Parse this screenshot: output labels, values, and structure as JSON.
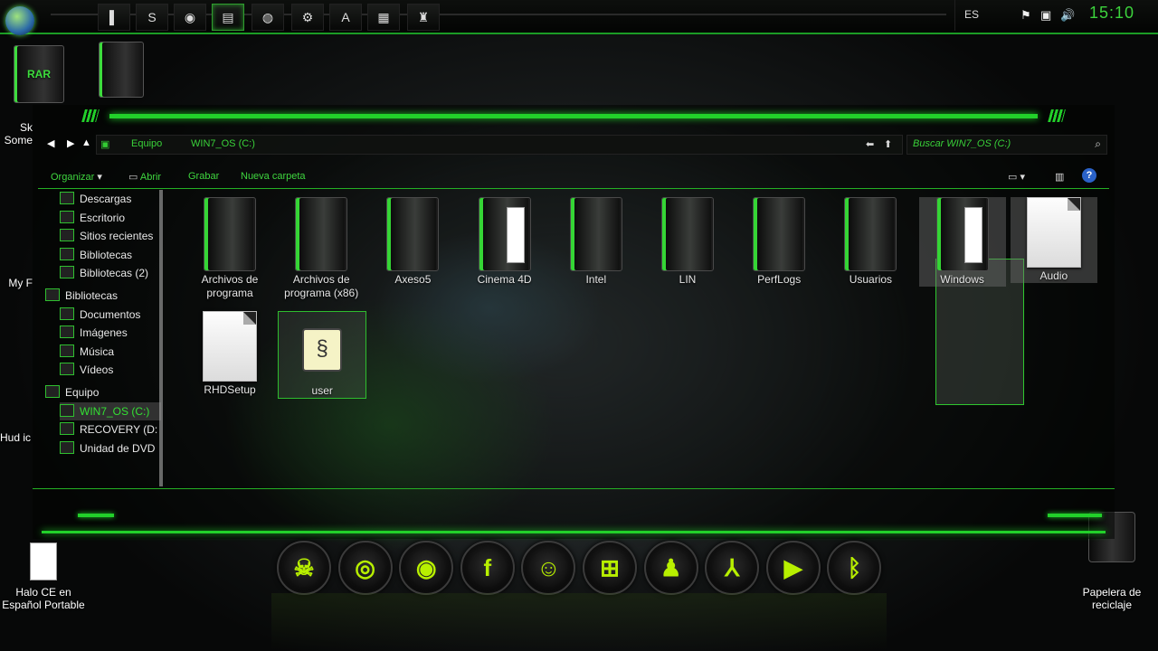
{
  "taskbar": {
    "lang": "ES",
    "clock": "15:10",
    "pinned": [
      {
        "name": "media-player-icon",
        "glyph": "▌"
      },
      {
        "name": "skype-icon",
        "glyph": "S"
      },
      {
        "name": "chrome-icon",
        "glyph": "◉"
      },
      {
        "name": "explorer-icon",
        "glyph": "▤",
        "active": true
      },
      {
        "name": "firefox-icon",
        "glyph": "◍"
      },
      {
        "name": "tools-icon",
        "glyph": "⚙"
      },
      {
        "name": "assassin-icon",
        "glyph": "A"
      },
      {
        "name": "app-icon",
        "glyph": "▦"
      },
      {
        "name": "media-icon",
        "glyph": "♜"
      }
    ]
  },
  "desktop": {
    "icons": [
      {
        "label": "Sk Some"
      },
      {
        "label": "My F"
      },
      {
        "label": "Hud ic"
      },
      {
        "label": "Halo CE en Español Portable"
      },
      {
        "label": "Papelera de reciclaje"
      }
    ],
    "rar_label": "RAR"
  },
  "explorer": {
    "breadcrumb": [
      "Equipo",
      "WIN7_OS (C:)"
    ],
    "search_placeholder": "Buscar WIN7_OS (C:)",
    "toolbar": {
      "organize": "Organizar",
      "open": "Abrir",
      "burn": "Grabar",
      "new_folder": "Nueva carpeta"
    },
    "nav": [
      {
        "label": "Descargas",
        "indent": 2
      },
      {
        "label": "Escritorio",
        "indent": 2
      },
      {
        "label": "Sitios recientes",
        "indent": 2
      },
      {
        "label": "Bibliotecas",
        "indent": 2
      },
      {
        "label": "Bibliotecas (2)",
        "indent": 2
      },
      {
        "label": "Bibliotecas",
        "indent": 1
      },
      {
        "label": "Documentos",
        "indent": 2
      },
      {
        "label": "Imágenes",
        "indent": 2
      },
      {
        "label": "Música",
        "indent": 2
      },
      {
        "label": "Vídeos",
        "indent": 2
      },
      {
        "label": "Equipo",
        "indent": 1
      },
      {
        "label": "WIN7_OS (C:)",
        "indent": 2,
        "selected": true
      },
      {
        "label": "RECOVERY (D:",
        "indent": 2
      },
      {
        "label": "Unidad de DVD",
        "indent": 2
      }
    ],
    "files": [
      {
        "label": "Archivos de programa",
        "type": "folder"
      },
      {
        "label": "Archivos de programa (x86)",
        "type": "folder"
      },
      {
        "label": "Axeso5",
        "type": "folder"
      },
      {
        "label": "Cinema 4D",
        "type": "folder-doc"
      },
      {
        "label": "Intel",
        "type": "folder"
      },
      {
        "label": "LIN",
        "type": "folder"
      },
      {
        "label": "PerfLogs",
        "type": "folder"
      },
      {
        "label": "Usuarios",
        "type": "folder"
      },
      {
        "label": "Windows",
        "type": "folder-doc",
        "state": "hover"
      },
      {
        "label": "Audio",
        "type": "doc",
        "state": "hover"
      },
      {
        "label": "RHDSetup",
        "type": "doc"
      },
      {
        "label": "user",
        "type": "user",
        "state": "selected"
      }
    ]
  },
  "dock": [
    {
      "name": "skull-icon",
      "glyph": "☠"
    },
    {
      "name": "chrome-dock-icon",
      "glyph": "◎"
    },
    {
      "name": "disc-icon",
      "glyph": "◉"
    },
    {
      "name": "facebook-icon",
      "glyph": "f"
    },
    {
      "name": "messenger-icon",
      "glyph": "☺"
    },
    {
      "name": "windows-icon",
      "glyph": "⊞"
    },
    {
      "name": "android-icon",
      "glyph": "♟"
    },
    {
      "name": "acrobat-icon",
      "glyph": "⅄"
    },
    {
      "name": "play-icon",
      "glyph": "▶"
    },
    {
      "name": "bluetooth-icon",
      "glyph": "ᛒ"
    }
  ]
}
